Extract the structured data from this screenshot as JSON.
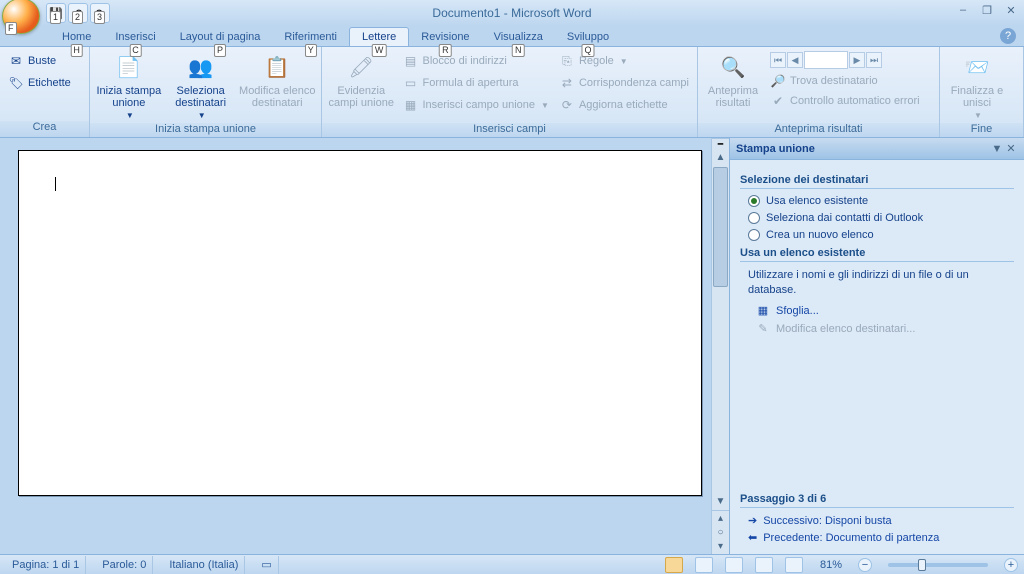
{
  "window": {
    "title": "Documento1 - Microsoft Word"
  },
  "qat_keys": [
    "1",
    "2",
    "3"
  ],
  "office_key": "F",
  "tabs": [
    {
      "label": "Home",
      "key": "H"
    },
    {
      "label": "Inserisci",
      "key": "C"
    },
    {
      "label": "Layout di pagina",
      "key": "P"
    },
    {
      "label": "Riferimenti",
      "key": "Y"
    },
    {
      "label": "Lettere",
      "key": "W",
      "active": true
    },
    {
      "label": "Revisione",
      "key": "R"
    },
    {
      "label": "Visualizza",
      "key": "N"
    },
    {
      "label": "Sviluppo",
      "key": "Q"
    }
  ],
  "ribbon": {
    "crea": {
      "label": "Crea",
      "b1": "Buste",
      "b2": "Etichette"
    },
    "inizia": {
      "label": "Inizia stampa unione",
      "b1": "Inizia stampa unione",
      "b2": "Seleziona destinatari",
      "b3": "Modifica elenco destinatari"
    },
    "inserisci": {
      "label": "Inserisci campi",
      "b1": "Evidenzia campi unione",
      "s1": "Blocco di indirizzi",
      "s2": "Formula di apertura",
      "s3": "Inserisci campo unione",
      "s4": "Regole",
      "s5": "Corrispondenza campi",
      "s6": "Aggiorna etichette"
    },
    "anteprima": {
      "label": "Anteprima risultati",
      "b1": "Anteprima risultati",
      "s1": "Trova destinatario",
      "s2": "Controllo automatico errori"
    },
    "fine": {
      "label": "Fine",
      "b1": "Finalizza e unisci"
    }
  },
  "taskpane": {
    "title": "Stampa unione",
    "sec1": "Selezione dei destinatari",
    "r1": "Usa elenco esistente",
    "r2": "Seleziona dai contatti di Outlook",
    "r3": "Crea un nuovo elenco",
    "sec2": "Usa un elenco esistente",
    "desc": "Utilizzare i nomi e gli indirizzi di un file o di un database.",
    "link1": "Sfoglia...",
    "link2": "Modifica elenco destinatari...",
    "step": "Passaggio 3 di 6",
    "next": "Successivo: Disponi busta",
    "prev": "Precedente: Documento di partenza"
  },
  "status": {
    "page": "Pagina: 1 di 1",
    "words": "Parole: 0",
    "lang": "Italiano (Italia)",
    "zoom": "81%"
  }
}
